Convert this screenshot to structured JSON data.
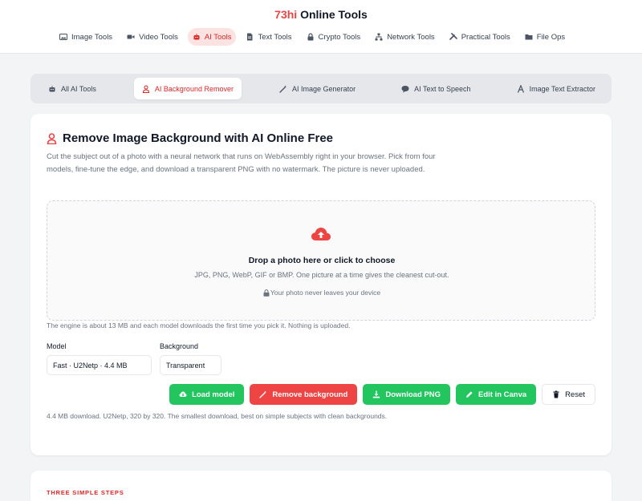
{
  "brand": {
    "prefix": "73hi",
    "name": " Online Tools"
  },
  "nav": {
    "items": [
      {
        "label": "Image Tools",
        "icon": "image-icon",
        "active": false
      },
      {
        "label": "Video Tools",
        "icon": "video-icon",
        "active": false
      },
      {
        "label": "AI Tools",
        "icon": "robot-icon",
        "active": true
      },
      {
        "label": "Text Tools",
        "icon": "document-icon",
        "active": false
      },
      {
        "label": "Crypto Tools",
        "icon": "lock-icon",
        "active": false
      },
      {
        "label": "Network Tools",
        "icon": "network-icon",
        "active": false
      },
      {
        "label": "Practical Tools",
        "icon": "wrench-icon",
        "active": false
      },
      {
        "label": "File Ops",
        "icon": "folder-icon",
        "active": false
      }
    ]
  },
  "subtabs": [
    {
      "label": "All AI Tools",
      "icon": "robot-icon",
      "active": false
    },
    {
      "label": "AI Background Remover",
      "icon": "person-icon",
      "active": true
    },
    {
      "label": "AI Image Generator",
      "icon": "magic-wand-icon",
      "active": false
    },
    {
      "label": "AI Text to Speech",
      "icon": "speech-bubble-icon",
      "active": false
    },
    {
      "label": "Image Text Extractor",
      "icon": "font-icon",
      "active": false
    }
  ],
  "card": {
    "title": "Remove Image Background with AI Online Free",
    "description": "Cut the subject out of a photo with a neural network that runs on WebAssembly right in your browser. Pick from four models, fine-tune the edge, and download a transparent PNG with no watermark. The picture is never uploaded.",
    "dropzone": {
      "title": "Drop a photo here or click to choose",
      "subtitle": "JPG, PNG, WebP, GIF or BMP. One picture at a time gives the cleanest cut-out.",
      "privacy": "Your photo never leaves your device"
    },
    "engine_note": "The engine is about 13 MB and each model downloads the first time you pick it. Nothing is uploaded.",
    "model": {
      "label": "Model",
      "value": "Fast · U2Netp · 4.4 MB"
    },
    "background": {
      "label": "Background",
      "value": "Transparent"
    },
    "buttons": {
      "load_model": "Load model",
      "remove_background": "Remove background",
      "download_png": "Download PNG",
      "edit_canva": "Edit in Canva",
      "reset": "Reset"
    },
    "model_note": "4.4 MB download. U2Netp, 320 by 320. The smallest download, best on simple subjects with clean backgrounds."
  },
  "steps": {
    "eyebrow": "THREE SIMPLE STEPS"
  },
  "colors": {
    "accent": "#ef4444",
    "green": "#22c55e",
    "page_bg": "#f3f4f6"
  }
}
